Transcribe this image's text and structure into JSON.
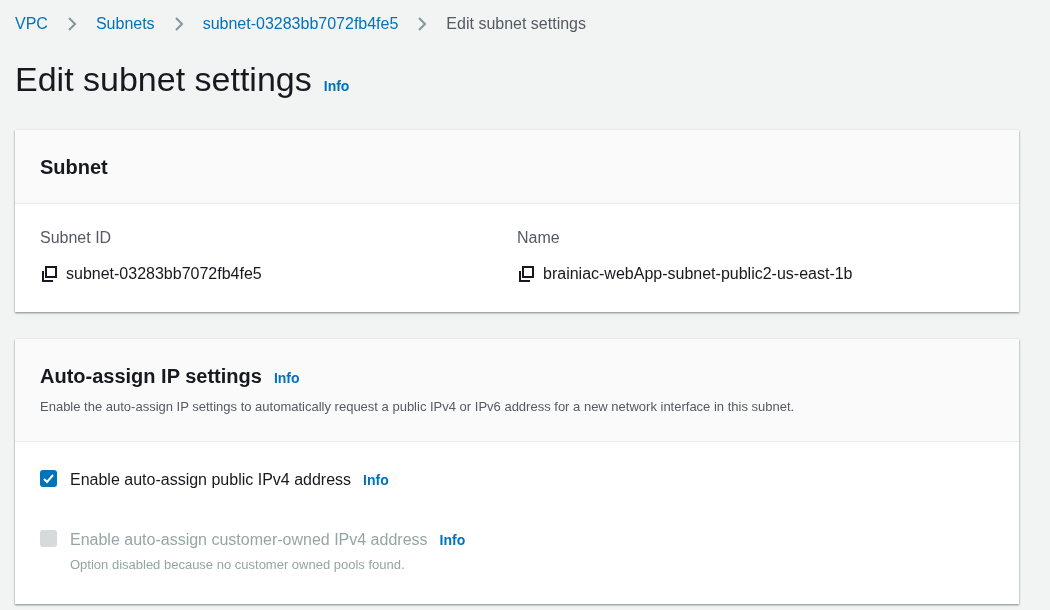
{
  "breadcrumbs": [
    {
      "label": "VPC",
      "kind": "link"
    },
    {
      "label": "Subnets",
      "kind": "link"
    },
    {
      "label": "subnet-03283bb7072fb4fe5",
      "kind": "link"
    },
    {
      "label": "Edit subnet settings",
      "kind": "current"
    }
  ],
  "page_title": "Edit subnet settings",
  "page_info": "Info",
  "subnet_panel": {
    "title": "Subnet",
    "fields": [
      {
        "label": "Subnet ID",
        "value": "subnet-03283bb7072fb4fe5"
      },
      {
        "label": "Name",
        "value": "brainiac-webApp-subnet-public2-us-east-1b"
      }
    ]
  },
  "auto_assign_panel": {
    "title": "Auto-assign IP settings",
    "info": "Info",
    "description": "Enable the auto-assign IP settings to automatically request a public IPv4 or IPv6 address for a new network interface in this subnet.",
    "options": [
      {
        "label": "Enable auto-assign public IPv4 address",
        "info": "Info",
        "checked": true,
        "disabled": false
      },
      {
        "label": "Enable auto-assign customer-owned IPv4 address",
        "info": "Info",
        "checked": false,
        "disabled": true,
        "description": "Option disabled because no customer owned pools found."
      }
    ]
  }
}
